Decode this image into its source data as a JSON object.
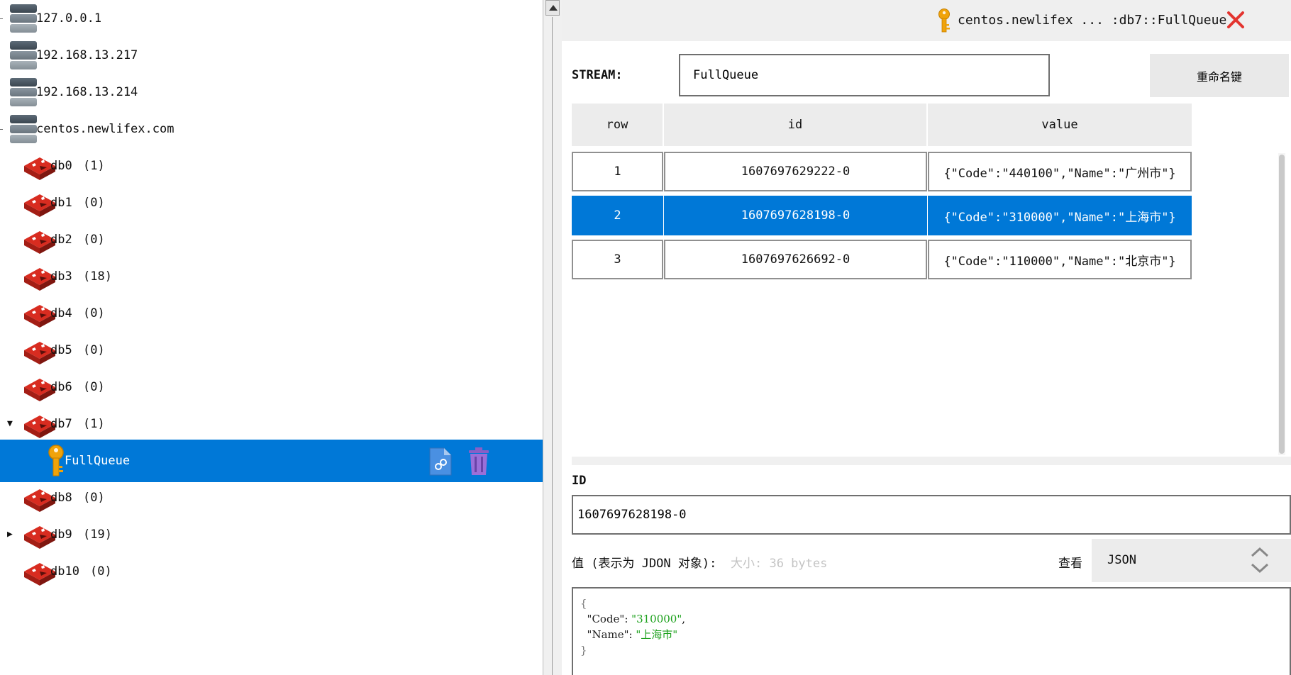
{
  "tree": {
    "servers": [
      {
        "label": "127.0.0.1"
      },
      {
        "label": "192.168.13.217"
      },
      {
        "label": "192.168.13.214"
      },
      {
        "label": "centos.newlifex.com"
      }
    ],
    "databases": [
      {
        "name": "db0",
        "count": "(1)"
      },
      {
        "name": "db1",
        "count": "(0)"
      },
      {
        "name": "db2",
        "count": "(0)"
      },
      {
        "name": "db3",
        "count": "(18)"
      },
      {
        "name": "db4",
        "count": "(0)"
      },
      {
        "name": "db5",
        "count": "(0)"
      },
      {
        "name": "db6",
        "count": "(0)"
      },
      {
        "name": "db7",
        "count": "(1)"
      },
      {
        "name": "db8",
        "count": "(0)"
      },
      {
        "name": "db9",
        "count": "(19)"
      },
      {
        "name": "db10",
        "count": "(0)"
      }
    ],
    "selected_key": "FullQueue",
    "colors": {
      "selection": "#0078d7",
      "redis_red": "#d82c20",
      "key_gold": "#f0a30a"
    }
  },
  "tab": {
    "title": "centos.newlifex  ...  :db7::FullQueue"
  },
  "stream": {
    "label": "STREAM:",
    "value": "FullQueue",
    "rename_button": "重命名键"
  },
  "table": {
    "columns": [
      "row",
      "id",
      "value"
    ],
    "rows": [
      {
        "row": "1",
        "id": "1607697629222-0",
        "value": "{\"Code\":\"440100\",\"Name\":\"广州市\"}",
        "selected": false
      },
      {
        "row": "2",
        "id": "1607697628198-0",
        "value": "{\"Code\":\"310000\",\"Name\":\"上海市\"}",
        "selected": true
      },
      {
        "row": "3",
        "id": "1607697626692-0",
        "value": "{\"Code\":\"110000\",\"Name\":\"北京市\"}",
        "selected": false
      }
    ]
  },
  "detail": {
    "id_label": "ID",
    "id_value": "1607697628198-0",
    "value_label": "值 (表示为 JDON 对象):",
    "size_label": "大小: 36 bytes",
    "view_label": "查看",
    "view_mode": "JSON",
    "json_lines": {
      "open": "{",
      "k1": "\"Code\"",
      "v1": "\"310000\"",
      "k2": "\"Name\"",
      "v2": "\"上海市\"",
      "close": "}"
    }
  }
}
